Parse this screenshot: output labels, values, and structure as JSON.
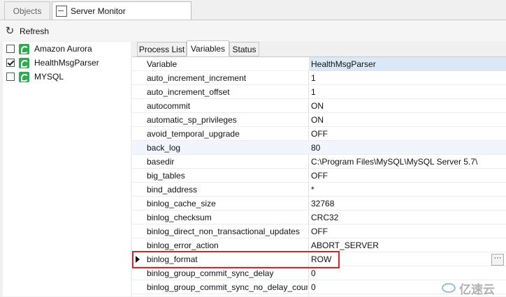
{
  "tabs": {
    "objects": "Objects",
    "server_monitor": "Server Monitor"
  },
  "toolbar": {
    "refresh": "Refresh"
  },
  "servers": [
    {
      "name": "Amazon Aurora",
      "checked": false
    },
    {
      "name": "HealthMsgParser",
      "checked": true
    },
    {
      "name": "MYSQL",
      "checked": false
    }
  ],
  "subtabs": {
    "process_list": "Process List",
    "variables": "Variables",
    "status": "Status"
  },
  "grid": {
    "header": {
      "variable": "Variable",
      "value": "HealthMsgParser"
    },
    "rows": [
      {
        "name": "auto_increment_increment",
        "value": "1"
      },
      {
        "name": "auto_increment_offset",
        "value": "1"
      },
      {
        "name": "autocommit",
        "value": "ON"
      },
      {
        "name": "automatic_sp_privileges",
        "value": "ON"
      },
      {
        "name": "avoid_temporal_upgrade",
        "value": "OFF"
      },
      {
        "name": "back_log",
        "value": "80"
      },
      {
        "name": "basedir",
        "value": "C:\\Program Files\\MySQL\\MySQL Server 5.7\\"
      },
      {
        "name": "big_tables",
        "value": "OFF"
      },
      {
        "name": "bind_address",
        "value": "*"
      },
      {
        "name": "binlog_cache_size",
        "value": "32768"
      },
      {
        "name": "binlog_checksum",
        "value": "CRC32"
      },
      {
        "name": "binlog_direct_non_transactional_updates",
        "value": "OFF"
      },
      {
        "name": "binlog_error_action",
        "value": "ABORT_SERVER"
      },
      {
        "name": "binlog_format",
        "value": "ROW"
      },
      {
        "name": "binlog_group_commit_sync_delay",
        "value": "0"
      },
      {
        "name": "binlog_group_commit_sync_no_delay_count",
        "value": "0"
      }
    ],
    "selected_row": "binlog_format",
    "ellipsis_label": "···"
  },
  "watermark": {
    "text": "亿速云",
    "icon": "cloud-logo-icon"
  },
  "colors": {
    "highlight": "#d0232a",
    "header_value_bg": "#dbe9f7",
    "server_icon": "#2fa84f"
  }
}
